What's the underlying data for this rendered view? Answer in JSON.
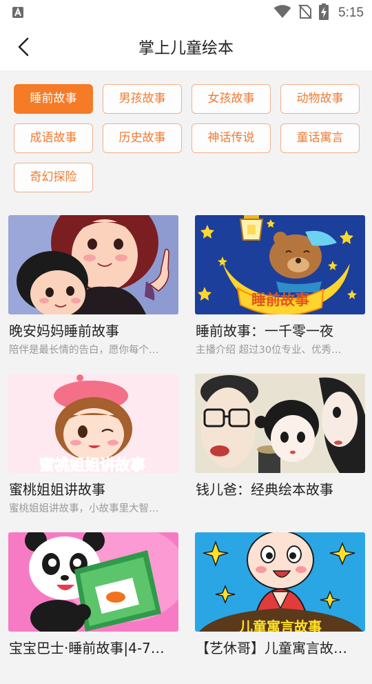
{
  "status_bar": {
    "time": "5:15",
    "icons": [
      "notification-a-icon",
      "wifi-icon",
      "no-sim-icon",
      "battery-charging-icon"
    ]
  },
  "header": {
    "title": "掌上儿童绘本",
    "back_icon": "chevron-left-icon"
  },
  "categories": [
    {
      "label": "睡前故事",
      "active": true
    },
    {
      "label": "男孩故事",
      "active": false
    },
    {
      "label": "女孩故事",
      "active": false
    },
    {
      "label": "动物故事",
      "active": false
    },
    {
      "label": "成语故事",
      "active": false
    },
    {
      "label": "历史故事",
      "active": false
    },
    {
      "label": "神话传说",
      "active": false
    },
    {
      "label": "童话寓言",
      "active": false
    },
    {
      "label": "奇幻探险",
      "active": false
    }
  ],
  "albums": [
    {
      "title": "晚安妈妈睡前故事",
      "desc": "陪伴是最长情的告白，愿你每个…"
    },
    {
      "title": "睡前故事：一千零一夜",
      "desc": "主播介绍 超过30位专业、优秀…"
    },
    {
      "title": "蜜桃姐姐讲故事",
      "desc": "蜜桃姐姐讲故事，小故事里大智…"
    },
    {
      "title": "钱儿爸：经典绘本故事",
      "desc": ""
    },
    {
      "title": "宝宝巴士·睡前故事|4-7…",
      "desc": ""
    },
    {
      "title": "【艺休哥】儿童寓言故…",
      "desc": ""
    }
  ],
  "thumb_captions": {
    "album2": "睡前故事",
    "album3": "蜜桃姐姐讲故事",
    "album6": "儿童寓言故事"
  },
  "colors": {
    "accent": "#f57b27",
    "chip_border": "#f1b08a",
    "chip_text": "#f07a33"
  }
}
